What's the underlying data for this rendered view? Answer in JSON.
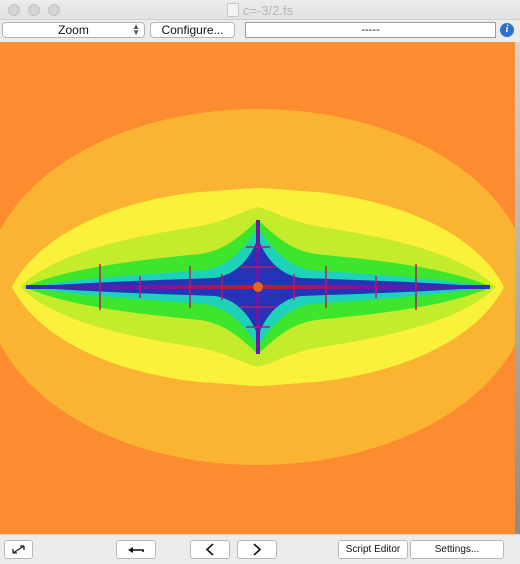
{
  "window": {
    "title": "c=-3/2.fs"
  },
  "toolbar": {
    "mode_select_value": "Zoom",
    "configure_label": "Configure...",
    "status_value": "-----"
  },
  "bottom_bar": {
    "script_editor_label": "Script Editor",
    "settings_label": "Settings..."
  },
  "colors": {
    "background_orange": "#fd8b2f",
    "outer_band": "#fbb432",
    "yellow_band": "#fbf03a",
    "lime_band": "#c5ec2c",
    "green_band": "#3de62c",
    "cyan_band": "#1dd2b8",
    "blue_core": "#2533b8",
    "purple_core": "#6a1aa8"
  },
  "icons": [
    "fullscreen-icon",
    "return-arrow-icon",
    "chevron-left-icon",
    "chevron-right-icon",
    "info-icon"
  ]
}
